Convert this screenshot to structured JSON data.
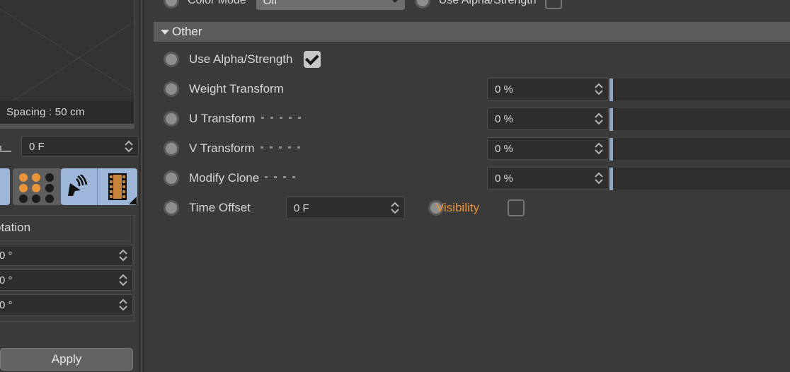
{
  "app": {
    "background_color": "#3b3b3b",
    "accent_orange": "#e8943a",
    "accent_blue": "#9db6d9"
  },
  "left_panel": {
    "viewport": {
      "tooltip_label": "Spacing : 50 cm",
      "icon": "viewport-grid"
    },
    "frame_field": {
      "value": "0 F",
      "unit": "F"
    },
    "toolbar_icons": [
      {
        "name": "dot-grid-icon",
        "label": "dot-grid"
      },
      {
        "name": "cursor-waves-icon",
        "label": "cursor-waves"
      },
      {
        "name": "film-strip-icon",
        "label": "film-strip"
      }
    ],
    "dot_grid_state": [
      true,
      true,
      false,
      true,
      true,
      false,
      false,
      false,
      false
    ],
    "rotation": {
      "title": "otation",
      "fields": [
        {
          "value": "0 °"
        },
        {
          "value": "0 °"
        },
        {
          "value": "0 °"
        }
      ]
    },
    "apply_button": {
      "label": "Apply"
    }
  },
  "main_panel": {
    "top_row": {
      "color_mode": {
        "label": "Color Mode",
        "value": "Off"
      },
      "use_alpha_strength": {
        "label": "Use Alpha/Strength",
        "checked": false
      }
    },
    "group": {
      "title": "Other",
      "expanded": true,
      "collapse_icon": "triangle-down-icon"
    },
    "rows": [
      {
        "name": "use-alpha-strength",
        "label": "Use Alpha/Strength",
        "type": "checkbox",
        "checked": true,
        "leader_dots": 0
      },
      {
        "name": "weight-transform",
        "label": "Weight Transform",
        "type": "percent-slider",
        "value": "0 %",
        "slider_position": 0,
        "leader_dots": 0
      },
      {
        "name": "u-transform",
        "label": "U Transform",
        "type": "percent-slider",
        "value": "0 %",
        "slider_position": 0,
        "leader_dots": 5
      },
      {
        "name": "v-transform",
        "label": "V Transform",
        "type": "percent-slider",
        "value": "0 %",
        "slider_position": 0,
        "leader_dots": 5
      },
      {
        "name": "modify-clone",
        "label": "Modify Clone",
        "type": "percent-slider",
        "value": "0 %",
        "slider_position": 0,
        "leader_dots": 4
      }
    ],
    "time_offset_row": {
      "label": "Time Offset",
      "value": "0 F",
      "visibility_label": "Visibility",
      "visibility_checked": false
    }
  }
}
